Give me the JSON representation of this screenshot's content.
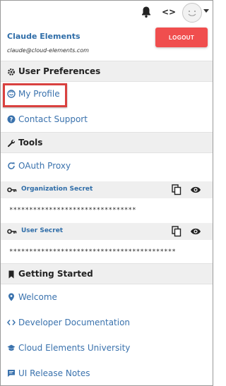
{
  "header": {
    "icons": [
      "bell-icon",
      "code-icon",
      "avatar-icon",
      "chevron-down-icon"
    ]
  },
  "user": {
    "name": "Claude Elements",
    "email": "claude@cloud-elements.com",
    "logout_label": "LOGOUT"
  },
  "colors": {
    "link": "#3a72ad",
    "logout": "#f04e4e",
    "section_bg": "#efefef",
    "highlight": "#d9413f"
  },
  "sections": {
    "user_preferences": {
      "title": "User Preferences",
      "icon": "gear-icon",
      "items": [
        {
          "label": "My Profile",
          "icon": "smile-icon"
        },
        {
          "label": "Contact Support",
          "icon": "question-icon"
        }
      ]
    },
    "tools": {
      "title": "Tools",
      "icon": "wrench-icon",
      "items": [
        {
          "label": "OAuth Proxy",
          "icon": "refresh-icon"
        }
      ],
      "secrets": [
        {
          "title": "Organization Secret",
          "value": "********************************"
        },
        {
          "title": "User Secret",
          "value": "******************************************"
        }
      ]
    },
    "getting_started": {
      "title": "Getting Started",
      "icon": "bookmark-icon",
      "items": [
        {
          "label": "Welcome",
          "icon": "map-pin-icon"
        },
        {
          "label": "Developer Documentation",
          "icon": "code-icon"
        },
        {
          "label": "Cloud Elements University",
          "icon": "graduation-cap-icon"
        },
        {
          "label": "UI Release Notes",
          "icon": "chat-icon"
        }
      ]
    }
  }
}
